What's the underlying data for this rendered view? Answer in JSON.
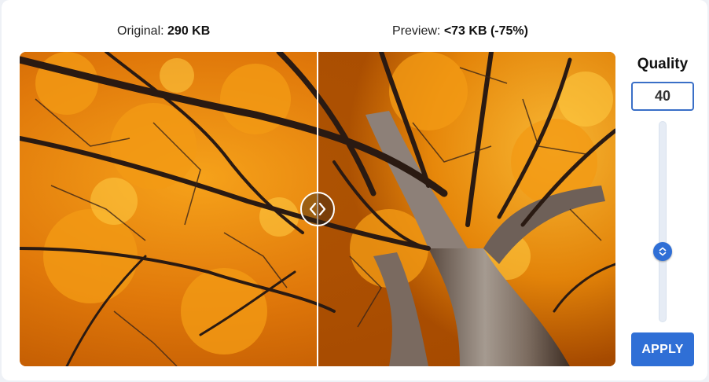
{
  "comparison": {
    "original_label": "Original:",
    "original_size": "290 KB",
    "preview_label": "Preview:",
    "preview_size": "<73 KB (-75%)",
    "divider_position_percent": 50
  },
  "quality": {
    "title": "Quality",
    "value": "40",
    "slider_value_percent": 40
  },
  "actions": {
    "apply_label": "APPLY"
  },
  "colors": {
    "accent": "#2f6fd6",
    "input_border": "#3a6fc7",
    "foliage": "#e88a0a",
    "branches": "#2a1a12"
  },
  "icons": {
    "compare_handle": "chevron-left-right-icon",
    "slider_thumb": "chevron-up-down-icon"
  }
}
